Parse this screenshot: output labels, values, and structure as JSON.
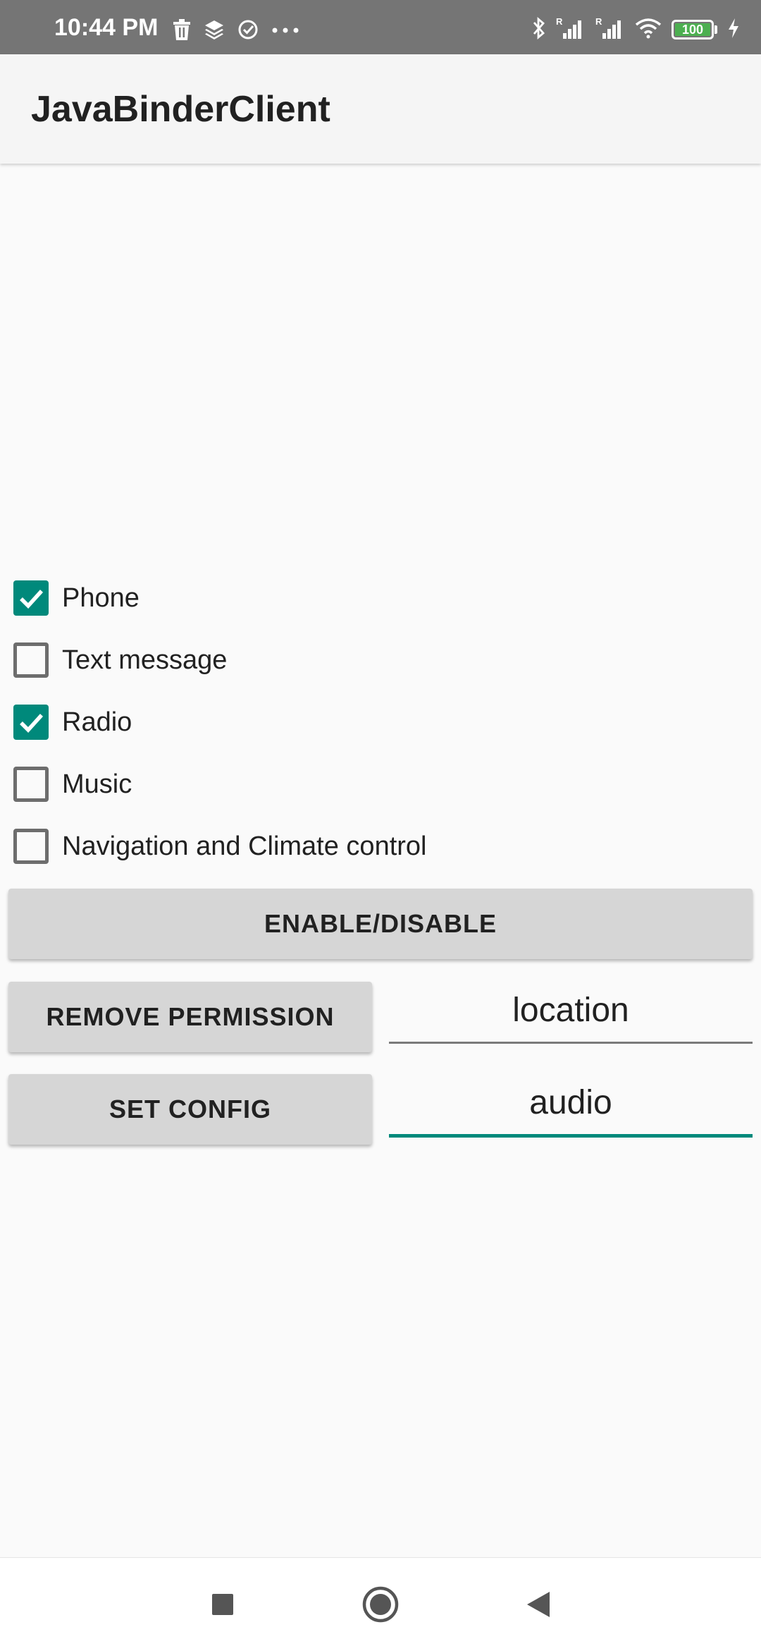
{
  "status_bar": {
    "time": "10:44 PM",
    "battery": "100",
    "icons_left": [
      "trash-icon",
      "layers-icon",
      "check-circle-icon",
      "more-dots-icon"
    ],
    "icons_right": [
      "bluetooth-icon",
      "signal-roaming-icon",
      "signal-roaming-icon",
      "wifi-icon",
      "battery-icon",
      "charging-icon"
    ]
  },
  "app_bar": {
    "title": "JavaBinderClient"
  },
  "checkboxes": [
    {
      "label": "Phone",
      "checked": true
    },
    {
      "label": "Text message",
      "checked": false
    },
    {
      "label": "Radio",
      "checked": true
    },
    {
      "label": "Music",
      "checked": false
    },
    {
      "label": "Navigation and Climate control",
      "checked": false
    }
  ],
  "buttons": {
    "enable_disable": "ENABLE/DISABLE",
    "remove_permission": "REMOVE PERMISSION",
    "set_config": "SET CONFIG"
  },
  "fields": {
    "permission_value": "location",
    "config_value": "audio"
  },
  "colors": {
    "accent": "#00897b",
    "status_bar": "#757575",
    "button_bg": "#d6d6d6",
    "battery_fill": "#4caf50"
  },
  "nav_bar": {
    "icons": [
      "recents-square-icon",
      "home-circle-icon",
      "back-triangle-icon"
    ]
  }
}
